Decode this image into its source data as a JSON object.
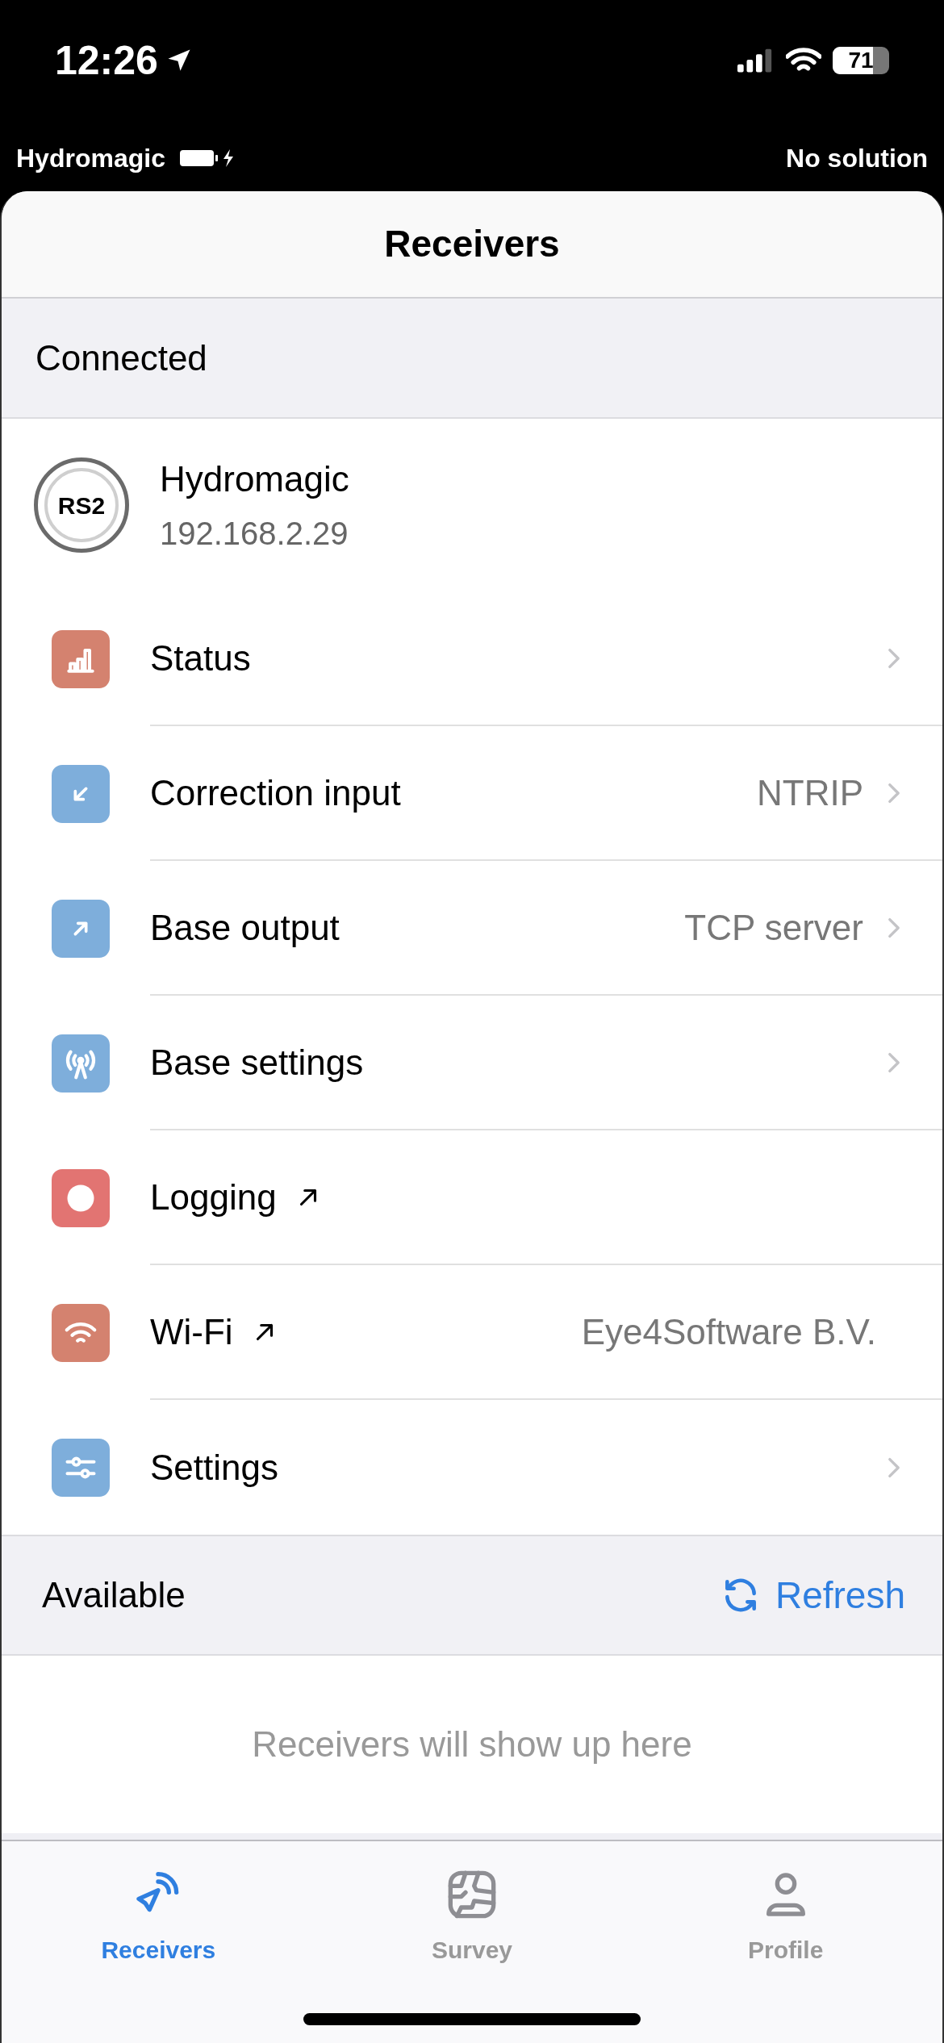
{
  "status_bar": {
    "time": "12:26",
    "battery": "71"
  },
  "info_bar": {
    "device": "Hydromagic",
    "solution": "No solution"
  },
  "header": {
    "title": "Receivers"
  },
  "connected": {
    "title": "Connected",
    "device": {
      "badge": "RS2",
      "name": "Hydromagic",
      "address": "192.168.2.29"
    },
    "rows": [
      {
        "label": "Status",
        "color": "#d4826f",
        "chevron": true,
        "external": false
      },
      {
        "label": "Correction input",
        "value": "NTRIP",
        "color": "#7eaedb",
        "chevron": true,
        "external": false
      },
      {
        "label": "Base output",
        "value": "TCP server",
        "color": "#7eaedb",
        "chevron": true,
        "external": false
      },
      {
        "label": "Base settings",
        "color": "#7eaedb",
        "chevron": true,
        "external": false
      },
      {
        "label": "Logging",
        "color": "#e27472",
        "chevron": false,
        "external": true
      },
      {
        "label": "Wi-Fi",
        "value": "Eye4Software B.V.",
        "color": "#d4826f",
        "chevron": false,
        "external": true
      },
      {
        "label": "Settings",
        "color": "#7eaedb",
        "chevron": true,
        "external": false
      }
    ]
  },
  "available": {
    "title": "Available",
    "refresh": "Refresh",
    "empty": "Receivers will show up here"
  },
  "tab_bar": [
    {
      "label": "Receivers",
      "selected": true
    },
    {
      "label": "Survey",
      "selected": false
    },
    {
      "label": "Profile",
      "selected": false
    }
  ]
}
